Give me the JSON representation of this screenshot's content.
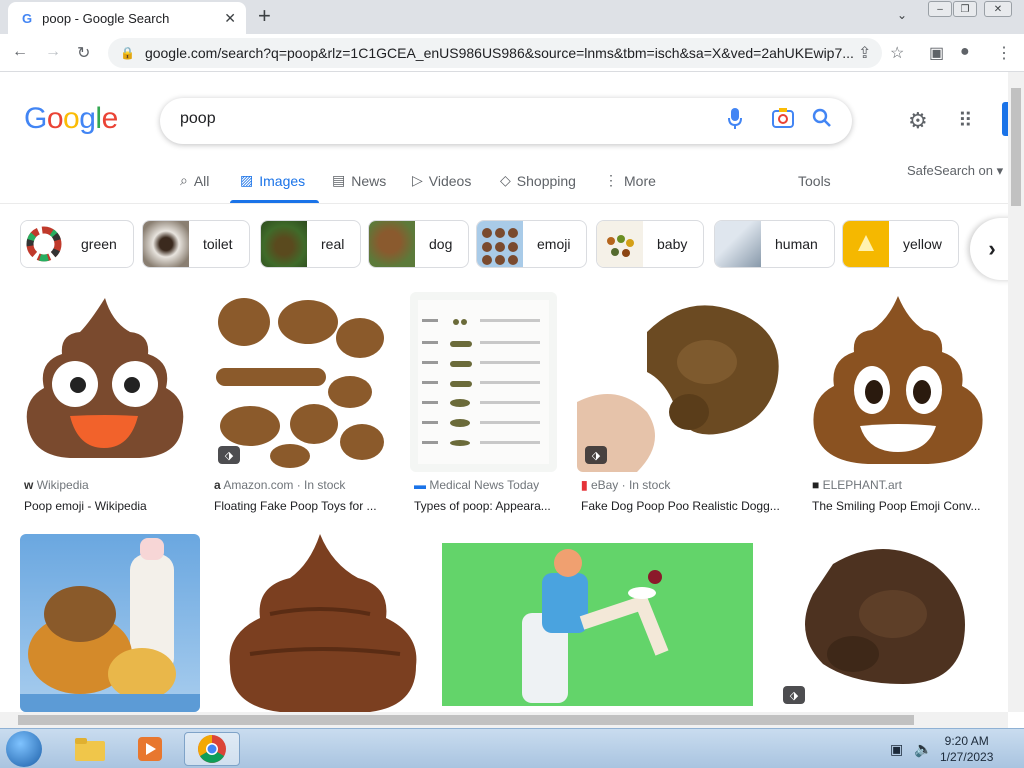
{
  "browser": {
    "tab_title": "poop - Google Search",
    "url": "google.com/search?q=poop&rlz=1C1GCEA_enUS986US986&source=lnms&tbm=isch&sa=X&ved=2ahUKEwip7..."
  },
  "google": {
    "logo": "Google",
    "query": "poop",
    "tabs": [
      {
        "label": "All",
        "icon": "search-icon"
      },
      {
        "label": "Images",
        "icon": "image-icon"
      },
      {
        "label": "News",
        "icon": "news-icon"
      },
      {
        "label": "Videos",
        "icon": "play-icon"
      },
      {
        "label": "Shopping",
        "icon": "tag-icon"
      },
      {
        "label": "More",
        "icon": "kebab-icon"
      }
    ],
    "tools": "Tools",
    "safesearch": "SafeSearch on"
  },
  "chips": [
    "green",
    "toilet",
    "real",
    "dog",
    "emoji",
    "baby",
    "human",
    "yellow"
  ],
  "results": [
    {
      "source": "Wikipedia",
      "title": "Poop emoji - Wikipedia"
    },
    {
      "source": "Amazon.com · In stock",
      "title": "Floating Fake Poop Toys for ..."
    },
    {
      "source": "Medical News Today",
      "title": "Types of poop: Appeara..."
    },
    {
      "source": "eBay · In stock",
      "title": "Fake Dog Poop Poo Realistic Dogg..."
    },
    {
      "source": "ELEPHANT.art",
      "title": "The Smiling Poop Emoji Conv..."
    }
  ],
  "taskbar": {
    "time": "9:20 AM",
    "date": "1/27/2023"
  },
  "colors": {
    "accent": "#1a73e8",
    "poop_brown": "#7a4a2e"
  }
}
